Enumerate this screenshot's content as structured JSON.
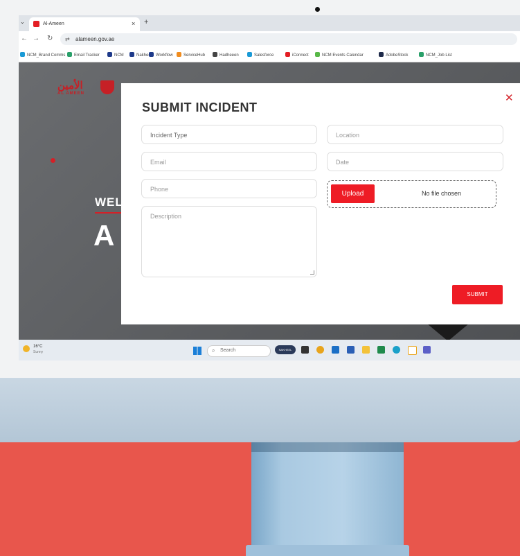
{
  "browser": {
    "tab_title": "Al-Ameen",
    "tab_close": "×",
    "new_tab": "+",
    "tab_menu": "⌄",
    "url": "alameen.gov.ae",
    "bookmarks": [
      {
        "label": "NCM_Brand Comms",
        "color": "#1a9ad6"
      },
      {
        "label": "Email Tracker",
        "color": "#2aa06a"
      },
      {
        "label": "NCM",
        "color": "#1e3a8a"
      },
      {
        "label": "Nakheel",
        "color": "#1e3a8a"
      },
      {
        "label": "Workflow",
        "color": "#1e3a8a"
      },
      {
        "label": "ServiceHub",
        "color": "#f08c1e"
      },
      {
        "label": "Hadheeen",
        "color": "#444444"
      },
      {
        "label": "Salesforce",
        "color": "#1a9ad6"
      },
      {
        "label": "iConnect",
        "color": "#e31e24"
      },
      {
        "label": "NCM Events Calendar",
        "color": "#58b848"
      },
      {
        "label": "AdobeStock",
        "color": "#1e2a4a"
      },
      {
        "label": "NCM_Job List",
        "color": "#2aa06a"
      }
    ]
  },
  "site": {
    "logo_arabic": "الأمين",
    "logo_english": "AL AMEEN",
    "welcome": "WEL",
    "headline": "A"
  },
  "modal": {
    "title": "SUBMIT INCIDENT",
    "close": "✕",
    "incident_type": "Incident Type",
    "location": "Location",
    "email": "Email",
    "date": "Date",
    "phone": "Phone",
    "description": "Description",
    "upload_label": "Upload",
    "upload_status": "No file chosen",
    "submit_label": "SUBMIT"
  },
  "taskbar": {
    "temperature": "16°C",
    "condition": "Sunny",
    "search_label": "Search",
    "pinned_app": "NAKHEEL"
  },
  "colors": {
    "accent": "#ee1c25",
    "background": "#e8564c"
  }
}
